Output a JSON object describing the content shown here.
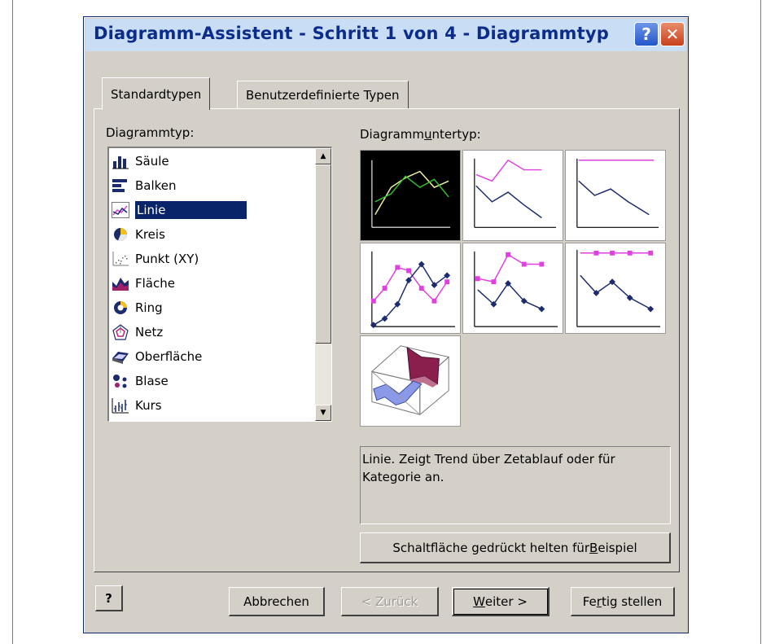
{
  "window": {
    "title": "Diagramm-Assistent - Schritt 1 von 4 - Diagrammtyp",
    "help_glyph": "?",
    "close_glyph": "✕"
  },
  "tabs": [
    {
      "label": "Standardtypen",
      "active": true
    },
    {
      "label": "Benutzerdefinierte Typen",
      "active": false
    }
  ],
  "chart_type": {
    "label_pre": "Dia",
    "label_mnemonic": "g",
    "label_post": "rammtyp:",
    "items": [
      {
        "label": "Säule",
        "icon": "column-chart-icon"
      },
      {
        "label": "Balken",
        "icon": "bar-chart-icon"
      },
      {
        "label": "Linie",
        "icon": "line-chart-icon",
        "selected": true
      },
      {
        "label": "Kreis",
        "icon": "pie-chart-icon"
      },
      {
        "label": "Punkt (XY)",
        "icon": "scatter-chart-icon"
      },
      {
        "label": "Fläche",
        "icon": "area-chart-icon"
      },
      {
        "label": "Ring",
        "icon": "doughnut-chart-icon"
      },
      {
        "label": "Netz",
        "icon": "radar-chart-icon"
      },
      {
        "label": "Oberfläche",
        "icon": "surface-chart-icon"
      },
      {
        "label": "Blase",
        "icon": "bubble-chart-icon"
      },
      {
        "label": "Kurs",
        "icon": "stock-chart-icon"
      }
    ]
  },
  "subtype": {
    "label_pre": "Diagramm",
    "label_mnemonic": "u",
    "label_post": "ntertyp:",
    "selected_index": 0
  },
  "description": "Linie. Zeigt Trend über Zetablauf oder für Kategorie an.",
  "preview_button": {
    "label_pre": "Schaltfläche gedrückt helten für ",
    "label_mnemonic": "B",
    "label_post": "eispiel"
  },
  "footer": {
    "help_glyph": "?",
    "cancel": "Abbrechen",
    "back": "< Zurück",
    "next_mnemonic": "W",
    "next_post": "eiter >",
    "finish_pre": "Fe",
    "finish_mnemonic": "r",
    "finish_post": "tig stellen"
  },
  "colors": {
    "dialog_face": "#d4d0c8",
    "title_text": "#0b2c8a",
    "selection": "#0a246a",
    "series_magenta": "#e040e0",
    "series_navy": "#1c2a6e"
  }
}
